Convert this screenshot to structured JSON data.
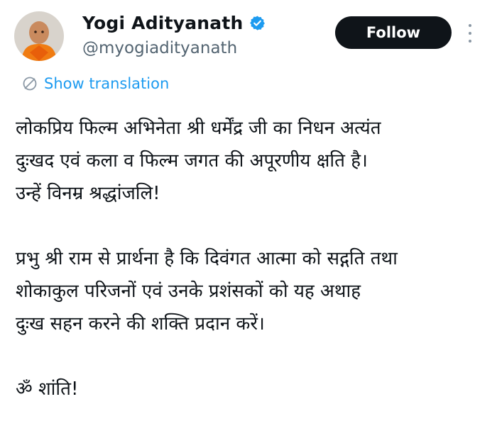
{
  "author": {
    "display_name": "Yogi Adityanath",
    "handle": "@myogiadityanath",
    "verified": true,
    "verified_color": "#1d9bf0"
  },
  "actions": {
    "follow_label": "Follow",
    "more_icon": "more-vertical-icon"
  },
  "translation": {
    "label": "Show translation",
    "icon": "globe-icon",
    "color": "#1d9bf0"
  },
  "post": {
    "lines_p1": [
      "लोकप्रिय फिल्म अभिनेता श्री धर्मेंद्र जी का निधन अत्यंत",
      "दुःखद एवं कला व फिल्म जगत की अपूरणीय क्षति है।",
      "उन्हें विनम्र श्रद्धांजलि!"
    ],
    "lines_p2": [
      "प्रभु श्री राम से प्रार्थना है कि दिवंगत आत्मा को सद्गति तथा",
      "शोकाकुल परिजनों एवं उनके प्रशंसकों को यह अथाह",
      "दुःख सहन करने की शक्ति प्रदान करें।"
    ],
    "lines_p3": [
      "ॐ शांति!"
    ]
  }
}
